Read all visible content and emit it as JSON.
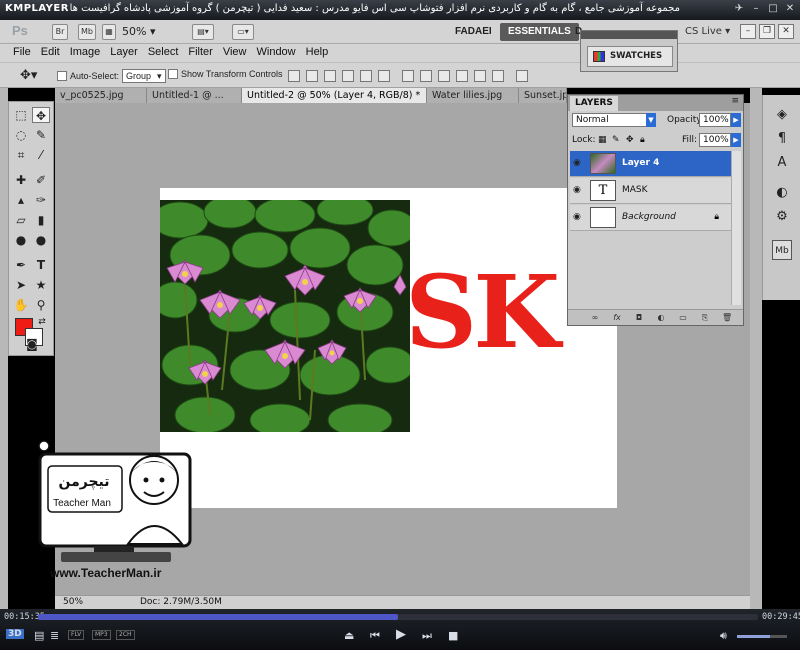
{
  "player": {
    "logo": "KMPLAYER",
    "caption": "مجموعه آموزشی جامع ، گام به گام و کاربردی نرم افزار فتوشاپ سی اس فایو  مدرس : سعید فدایی ( تیچرمن ) گروه آموزشی پادشاه گرافیست ها",
    "elapsed": "00:15:35",
    "total": "00:29:45",
    "progress": 0.5,
    "volume": 0.65,
    "badge_3d": "3D",
    "format_badges": [
      "FLV",
      "MP3",
      "2CH"
    ]
  },
  "ps": {
    "logo": "Ps",
    "chip_br": "Br",
    "chip_mb": "Mb",
    "zoom_select": "50%",
    "workspaces": [
      "FADAEI",
      "ESSENTIALS",
      "D"
    ],
    "cs_live": "CS Live"
  },
  "menu": [
    "File",
    "Edit",
    "Image",
    "Layer",
    "Select",
    "Filter",
    "View",
    "Window",
    "Help"
  ],
  "options": {
    "auto_select_label": "Auto-Select:",
    "auto_select_value": "Group",
    "show_transform_label": "Show Transform Controls"
  },
  "tabs": [
    "v_pc0525.jpg",
    "Untitled-1 @ ...",
    "Untitled-2 @ 50% (Layer 4, RGB/8) *",
    "Water lilies.jpg",
    "Sunset.jpg"
  ],
  "canvas": {
    "mask_text": "SK"
  },
  "status": {
    "zoom": "50%",
    "doc": "Doc: 2.79M/3.50M"
  },
  "swatches": {
    "label": "SWATCHES"
  },
  "layers": {
    "title": "LAYERS",
    "blend_mode": "Normal",
    "opacity_label": "Opacity:",
    "opacity": "100%",
    "lock_label": "Lock:",
    "fill_label": "Fill:",
    "fill": "100%",
    "items": [
      {
        "name": "Layer 4"
      },
      {
        "name": "MASK"
      },
      {
        "name": "Background"
      }
    ]
  },
  "watermark": {
    "url": "www.TeacherMan.ir",
    "brand": "Teacher Man"
  },
  "colors": {
    "foreground": "#ef1c16",
    "background": "#ffffff",
    "selected_layer": "#2c65c6",
    "mask_text": "#e8211a"
  }
}
